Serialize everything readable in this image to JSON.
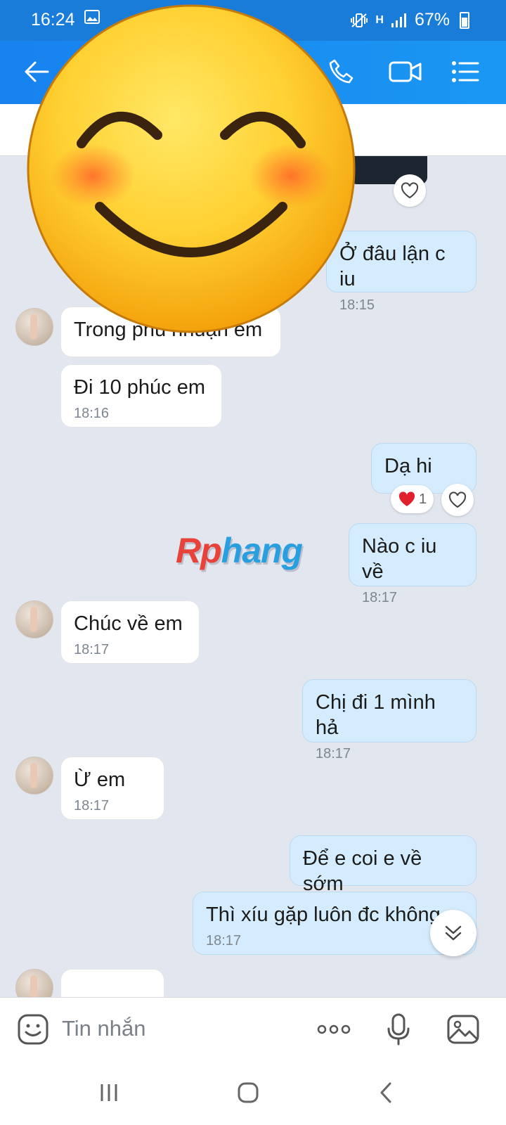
{
  "status_bar": {
    "time": "16:24",
    "network": "H",
    "battery": "67%"
  },
  "composer": {
    "placeholder": "Tin nhắn"
  },
  "watermark": {
    "part1": "Rp",
    "part2": "hang"
  },
  "messages": [
    {
      "text": "Ở đâu lận c iu",
      "time": "18:15"
    },
    {
      "text": "Trong phú nhuận em"
    },
    {
      "text": "Đi 10 phúc em",
      "time": "18:16"
    },
    {
      "text": "Dạ hi",
      "reaction_count": "1"
    },
    {
      "text": "Nào c iu về",
      "time": "18:17"
    },
    {
      "text": "Chúc về em",
      "time": "18:17"
    },
    {
      "text": "Chị đi 1 mình hả",
      "time": "18:17"
    },
    {
      "text": "Ừ em",
      "time": "18:17"
    },
    {
      "text": "Để e coi e về sớm"
    },
    {
      "text": "Thì xíu gặp luôn đc không",
      "time": "18:17"
    }
  ]
}
